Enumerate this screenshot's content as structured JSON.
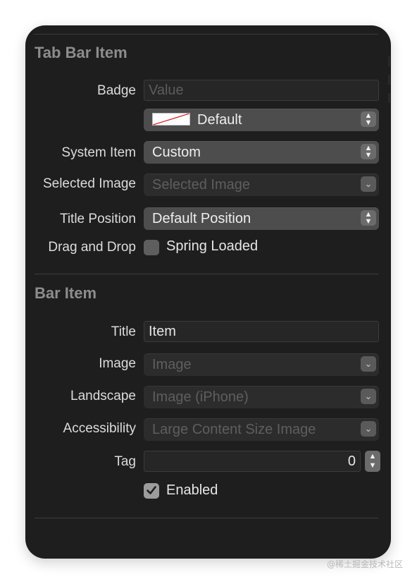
{
  "tab_bar_item": {
    "section_title": "Tab Bar Item",
    "badge": {
      "label": "Badge",
      "placeholder": "Value"
    },
    "badge_color": {
      "value": "Default"
    },
    "system_item": {
      "label": "System Item",
      "value": "Custom"
    },
    "selected_image": {
      "label": "Selected Image",
      "placeholder": "Selected Image"
    },
    "title_position": {
      "label": "Title Position",
      "value": "Default Position"
    },
    "drag_and_drop": {
      "label": "Drag and Drop",
      "option": "Spring Loaded",
      "checked": false
    }
  },
  "bar_item": {
    "section_title": "Bar Item",
    "title": {
      "label": "Title",
      "value": "Item"
    },
    "image": {
      "label": "Image",
      "placeholder": "Image"
    },
    "landscape": {
      "label": "Landscape",
      "placeholder": "Image (iPhone)"
    },
    "accessibility": {
      "label": "Accessibility",
      "placeholder": "Large Content Size Image"
    },
    "tag": {
      "label": "Tag",
      "value": "0"
    },
    "enabled": {
      "label": "Enabled",
      "checked": true
    }
  },
  "watermark": "@稀土掘金技术社区",
  "icons": {
    "updown": "updown-chevron-icon",
    "down": "chevron-down-icon",
    "check": "checkmark-icon",
    "swatch": "color-swatch-icon"
  },
  "colors": {
    "panel_bg": "#1e1e1e",
    "popup_bg": "#4d4d4d",
    "section_title": "#8d8d8d",
    "label_text": "#dcdcdc"
  }
}
